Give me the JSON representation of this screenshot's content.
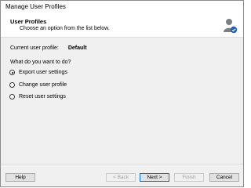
{
  "window": {
    "title": "Manage User Profiles"
  },
  "header": {
    "title": "User Profiles",
    "subtitle": "Choose an option from the list below.",
    "icon": "user-settings-icon"
  },
  "profile": {
    "label": "Current user profile:",
    "value": "Default"
  },
  "question": "What do you want to do?",
  "options": [
    {
      "label": "Export user settings",
      "selected": true
    },
    {
      "label": "Change user profile",
      "selected": false
    },
    {
      "label": "Reset user settings",
      "selected": false
    }
  ],
  "buttons": {
    "help": "Help",
    "back": "< Back",
    "next": "Next >",
    "finish": "Finish",
    "cancel": "Cancel"
  }
}
